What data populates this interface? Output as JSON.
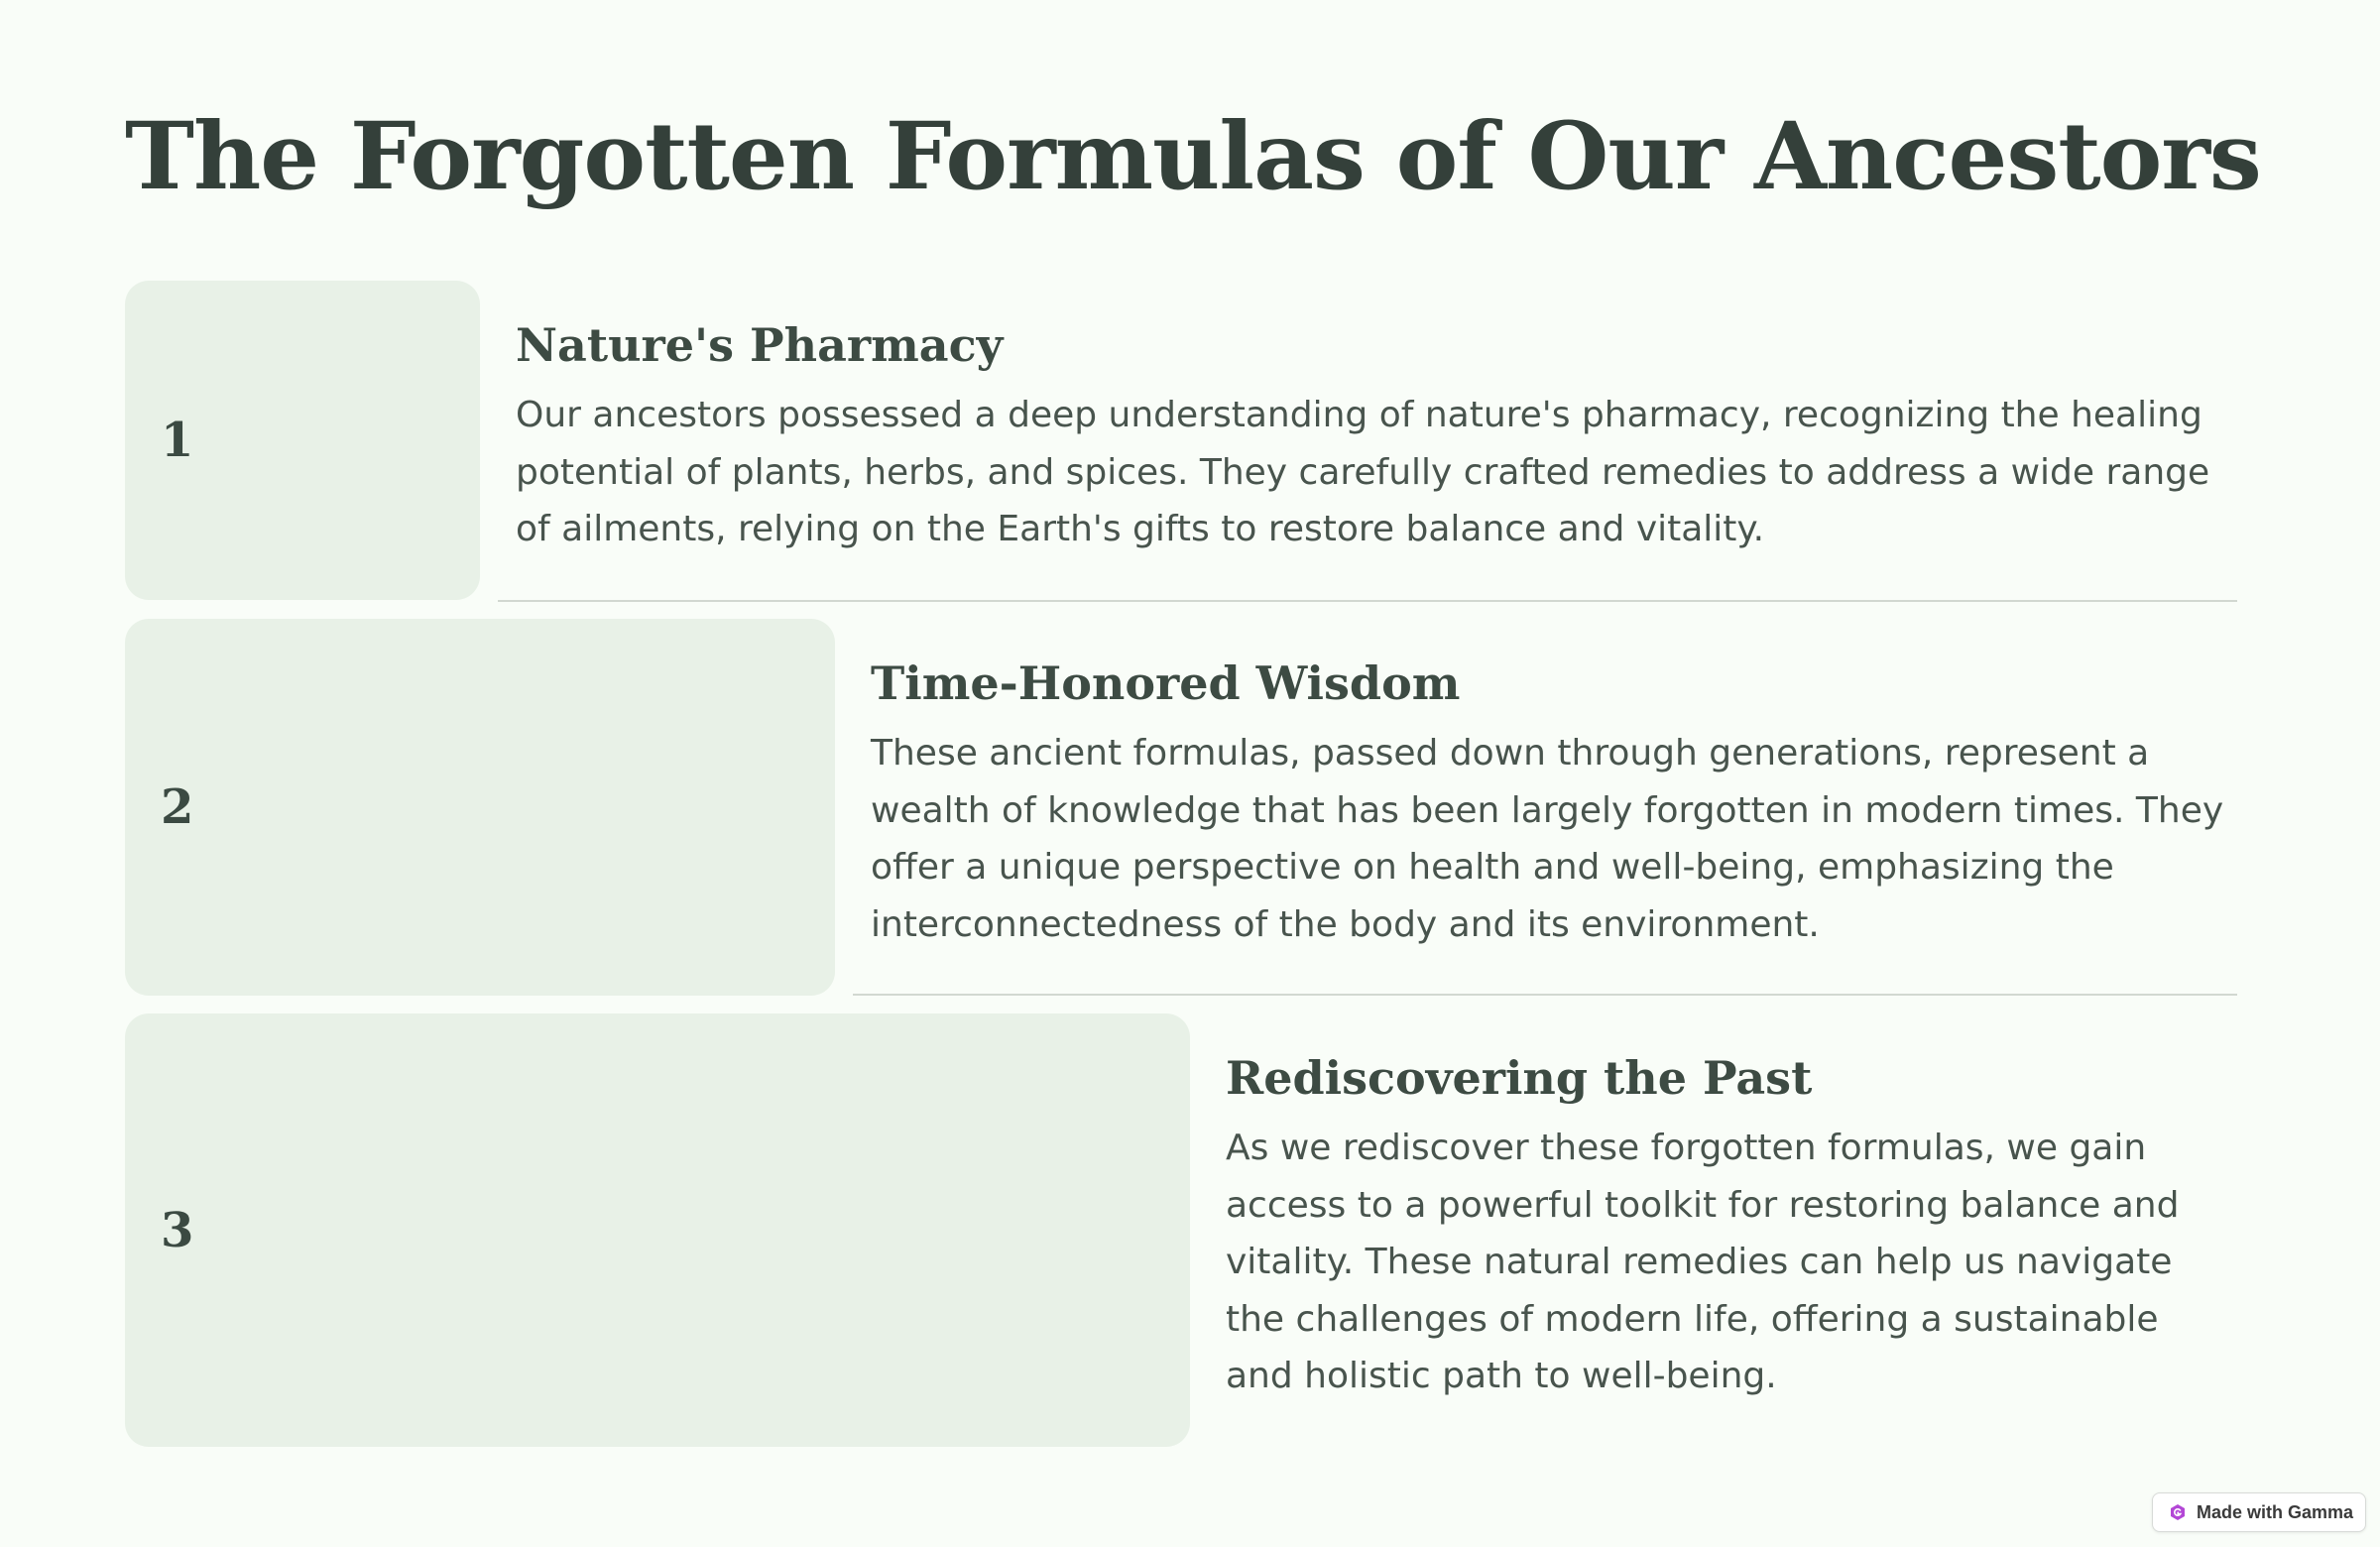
{
  "page": {
    "title": "The Forgotten Formulas of Our Ancestors"
  },
  "steps": [
    {
      "number": "1",
      "heading": "Nature's Pharmacy",
      "body": "Our ancestors possessed a deep understanding of nature's pharmacy, recognizing the healing potential of plants, herbs, and spices. They carefully crafted remedies to address a wide range of ailments, relying on the Earth's gifts to restore balance and vitality."
    },
    {
      "number": "2",
      "heading": "Time-Honored Wisdom",
      "body": "These ancient formulas, passed down through generations, represent a wealth of knowledge that has been largely forgotten in modern times. They offer a unique perspective on health and well-being, emphasizing the interconnectedness of the body and its environment."
    },
    {
      "number": "3",
      "heading": "Rediscovering the Past",
      "body": "As we rediscover these forgotten formulas, we gain access to a powerful toolkit for restoring balance and vitality. These natural remedies can help us navigate the challenges of modern life, offering a sustainable and holistic path to well-being."
    }
  ],
  "badge": {
    "label": "Made with Gamma",
    "icon": "gamma-logo-icon"
  },
  "colors": {
    "background": "#f9fdf8",
    "number_box": "#e8f1e7",
    "text": "#394640",
    "divider": "#d2d8d1",
    "badge_icon": "#b347d6"
  }
}
